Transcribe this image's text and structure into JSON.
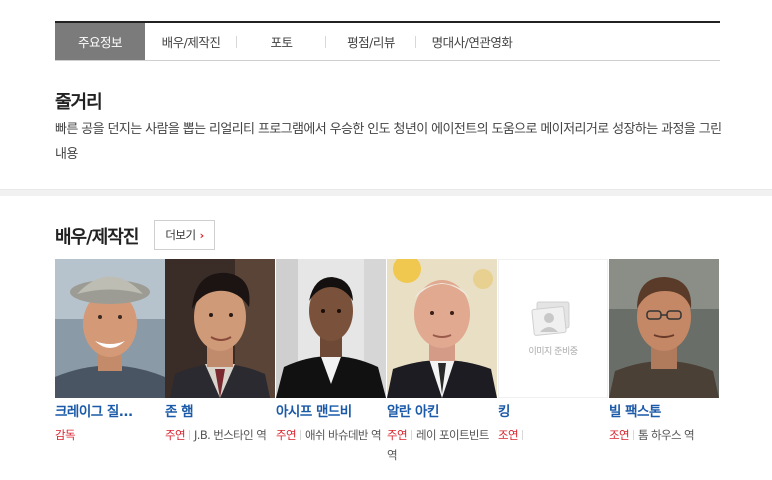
{
  "tabs": [
    {
      "label": "주요정보",
      "active": true
    },
    {
      "label": "배우/제작진",
      "active": false
    },
    {
      "label": "포토",
      "active": false
    },
    {
      "label": "평점/리뷰",
      "active": false
    },
    {
      "label": "명대사/연관영화",
      "active": false
    }
  ],
  "synopsis": {
    "title": "줄거리",
    "text": "빠른 공을 던지는 사람을 뽑는 리얼리티 프로그램에서 우승한 인도 청년이 에이전트의 도움으로 메이저리거로 성장하는 과정을 그린 내용"
  },
  "cast": {
    "title": "배우/제작진",
    "more_label": "더보기",
    "more_arrow": "›",
    "placeholder_text": "이미지 준비중",
    "items": [
      {
        "name": "크레이그 질...",
        "kind": "감독",
        "role": ""
      },
      {
        "name": "존 햄",
        "kind": "주연",
        "role": "J.B. 번스타인 역"
      },
      {
        "name": "아시프 맨드비",
        "kind": "주연",
        "role": "애쉬 바슈데반 역"
      },
      {
        "name": "알란 아킨",
        "kind": "주연",
        "role": "레이 포이트빈트 역"
      },
      {
        "name": "킹",
        "kind": "조연",
        "role": ""
      },
      {
        "name": "빌 팩스톤",
        "kind": "조연",
        "role": "톰 하우스 역"
      }
    ]
  }
}
